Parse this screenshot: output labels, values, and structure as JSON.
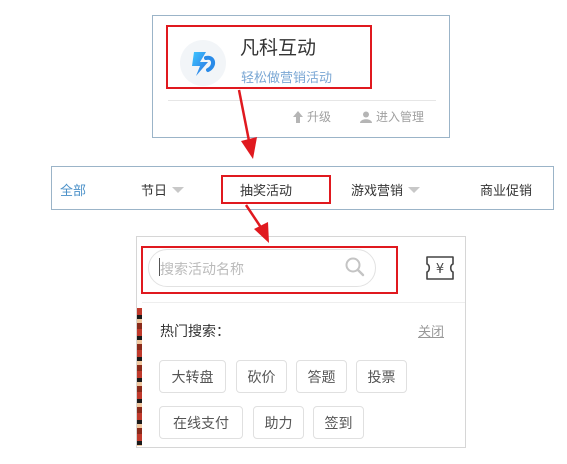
{
  "app_card": {
    "name": "凡科互动",
    "tagline": "轻松做营销活动",
    "upgrade_label": "升级",
    "manage_label": "进入管理"
  },
  "category_nav": {
    "items": [
      {
        "label": "全部",
        "active": true
      },
      {
        "label": "节日",
        "dropdown": true
      },
      {
        "label": "抽奖活动"
      },
      {
        "label": "游戏营销",
        "dropdown": true
      },
      {
        "label": "商业促销"
      }
    ]
  },
  "search": {
    "placeholder": "搜索活动名称",
    "wallet_symbol": "¥",
    "hot_title": "热门搜索：",
    "close_label": "关闭",
    "tags_row1": [
      "大转盘",
      "砍价",
      "答题",
      "投票"
    ],
    "tags_row2": [
      "在线支付",
      "助力",
      "签到"
    ]
  },
  "colors": {
    "highlight": "#e0191f",
    "link_blue": "#4a90c8",
    "tagline_blue": "#7aa7d4"
  }
}
